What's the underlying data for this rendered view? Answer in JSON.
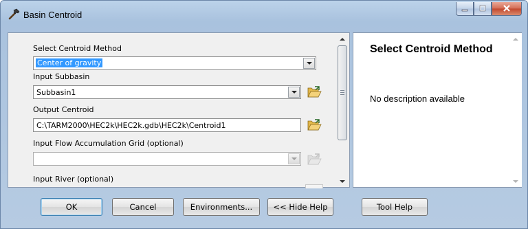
{
  "window": {
    "title": "Basin Centroid"
  },
  "form": {
    "centroid_method": {
      "label": "Select Centroid Method",
      "value": "Center of gravity"
    },
    "input_subbasin": {
      "label": "Input Subbasin",
      "value": "Subbasin1"
    },
    "output_centroid": {
      "label": "Output Centroid",
      "value": "C:\\TARM2000\\HEC2k\\HEC2k.gdb\\HEC2k\\Centroid1"
    },
    "flow_accumulation": {
      "label": "Input Flow Accumulation Grid (optional)",
      "value": ""
    },
    "input_river": {
      "label": "Input River (optional)"
    }
  },
  "help": {
    "title": "Select Centroid Method",
    "description": "No description available"
  },
  "buttons": {
    "ok": "OK",
    "cancel": "Cancel",
    "environments": "Environments...",
    "hide_help": "<< Hide Help",
    "tool_help": "Tool Help"
  },
  "colors": {
    "selection": "#3399ff",
    "close_button": "#c2472e",
    "title_bar": "#bcd3ea"
  },
  "icons": {
    "title": "hammer-icon",
    "browse": "open-folder-icon"
  }
}
